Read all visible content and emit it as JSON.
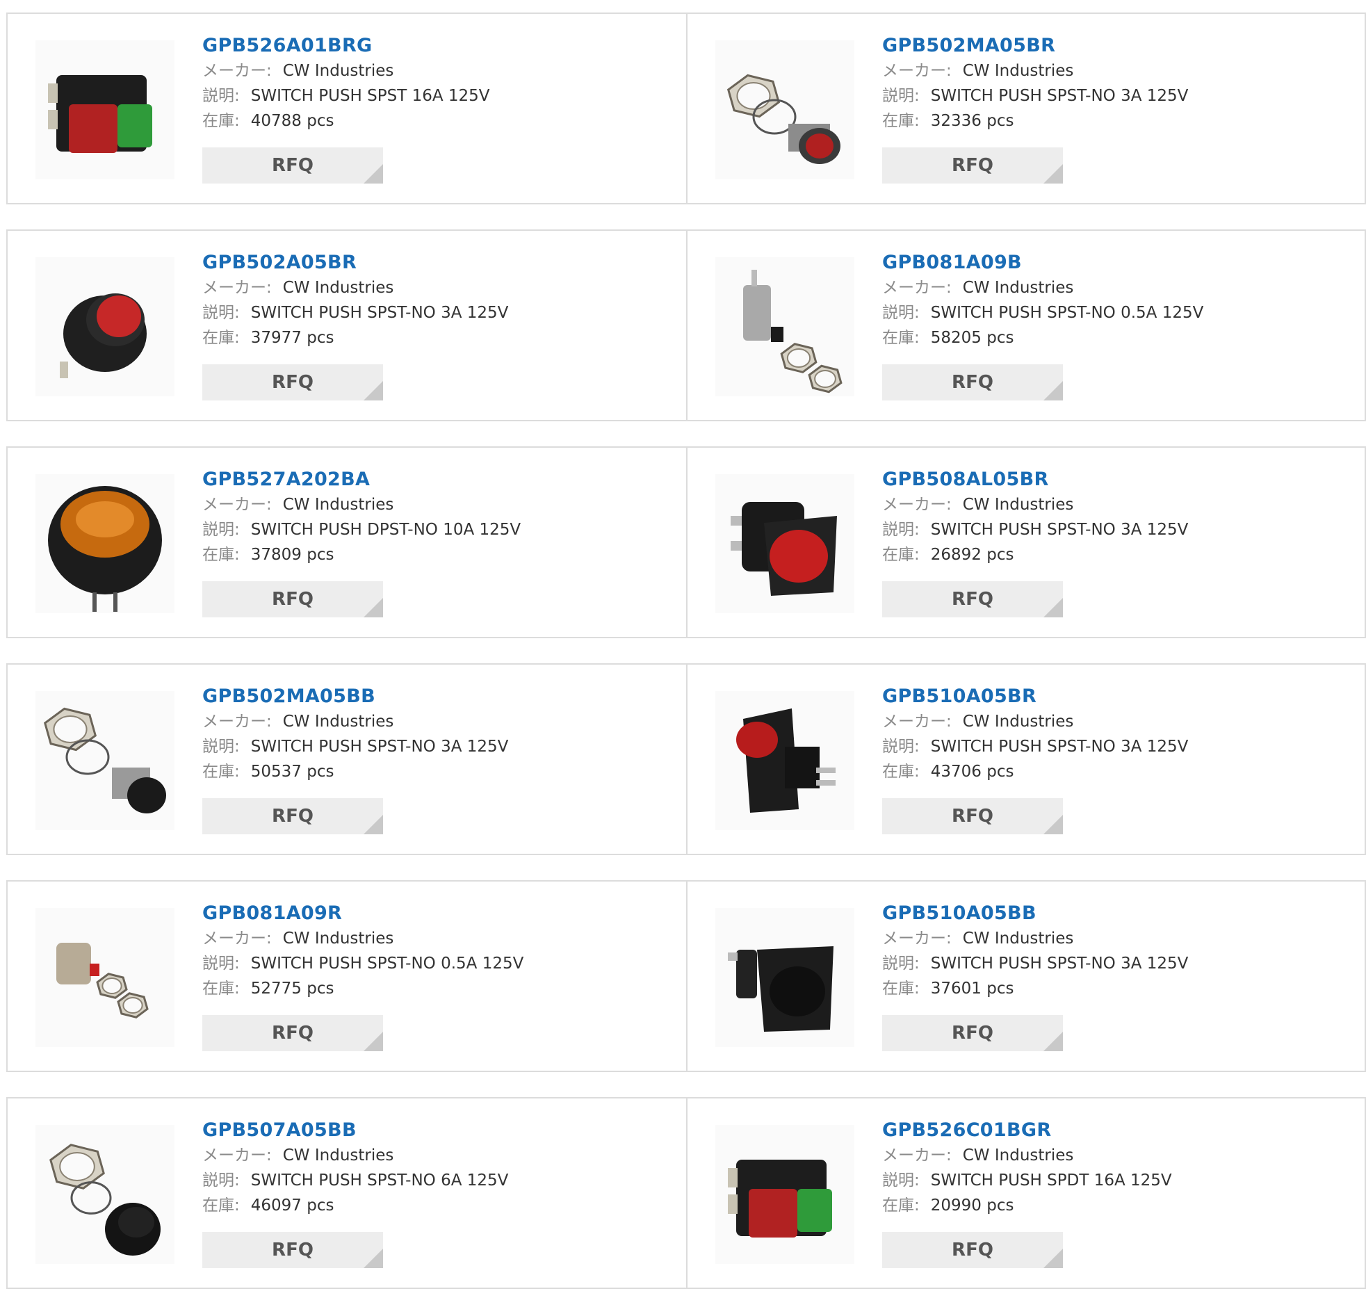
{
  "rfq_label": "RFQ",
  "labels": {
    "maker": "メーカー:",
    "desc": "説明:",
    "stock": "在庫:"
  },
  "products": [
    {
      "part": "GPB526A01BRG",
      "maker": "CW Industries",
      "desc": "SWITCH PUSH SPST 16A 125V",
      "stock": "40788 pcs",
      "image": "rocker-red-green"
    },
    {
      "part": "GPB502MA05BR",
      "maker": "CW Industries",
      "desc": "SWITCH PUSH SPST-NO 3A 125V",
      "stock": "32336 pcs",
      "image": "panel-red-nut"
    },
    {
      "part": "GPB502A05BR",
      "maker": "CW Industries",
      "desc": "SWITCH PUSH SPST-NO 3A 125V",
      "stock": "37977 pcs",
      "image": "round-red"
    },
    {
      "part": "GPB081A09B",
      "maker": "CW Industries",
      "desc": "SWITCH PUSH SPST-NO 0.5A 125V",
      "stock": "58205 pcs",
      "image": "mini-black-nut"
    },
    {
      "part": "GPB527A202BA",
      "maker": "CW Industries",
      "desc": "SWITCH PUSH DPST-NO 10A 125V",
      "stock": "37809 pcs",
      "image": "round-amber"
    },
    {
      "part": "GPB508AL05BR",
      "maker": "CW Industries",
      "desc": "SWITCH PUSH SPST-NO 3A 125V",
      "stock": "26892 pcs",
      "image": "square-red"
    },
    {
      "part": "GPB502MA05BB",
      "maker": "CW Industries",
      "desc": "SWITCH PUSH SPST-NO 3A 125V",
      "stock": "50537 pcs",
      "image": "panel-black-nut"
    },
    {
      "part": "GPB510A05BR",
      "maker": "CW Industries",
      "desc": "SWITCH PUSH SPST-NO 3A 125V",
      "stock": "43706 pcs",
      "image": "side-red"
    },
    {
      "part": "GPB081A09R",
      "maker": "CW Industries",
      "desc": "SWITCH PUSH SPST-NO 0.5A 125V",
      "stock": "52775 pcs",
      "image": "mini-red-nut"
    },
    {
      "part": "GPB510A05BB",
      "maker": "CW Industries",
      "desc": "SWITCH PUSH SPST-NO 3A 125V",
      "stock": "37601 pcs",
      "image": "square-black"
    },
    {
      "part": "GPB507A05BB",
      "maker": "CW Industries",
      "desc": "SWITCH PUSH SPST-NO 6A 125V",
      "stock": "46097 pcs",
      "image": "panel-black-nut2"
    },
    {
      "part": "GPB526C01BGR",
      "maker": "CW Industries",
      "desc": "SWITCH PUSH SPDT 16A 125V",
      "stock": "20990 pcs",
      "image": "rocker-red-green"
    }
  ],
  "colors": {
    "link": "#1a6cb5",
    "border": "#dcdcdc",
    "rfq_bg": "#ededed",
    "label_grey": "#8a8a8a"
  }
}
